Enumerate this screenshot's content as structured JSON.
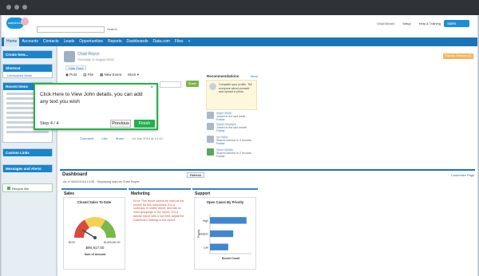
{
  "header": {
    "logo": "salesforce",
    "search_button": "Search",
    "user_menu": "Chad Brown",
    "setup": "Setup",
    "help": "Help & Training",
    "app_menu": "Sales"
  },
  "tabs": [
    "Home",
    "Accounts",
    "Contacts",
    "Leads",
    "Opportunities",
    "Reports",
    "Dashboards",
    "Data.com",
    "Files",
    "+"
  ],
  "sidebar": {
    "create_new": "Create New...",
    "shortcut": "Shortcut",
    "unresolved_items": "Unresolved Items",
    "recent_items": "Recent Items",
    "custom_links": "Custom Links",
    "messages_alerts": "Messages and Alerts",
    "recycle_bin": "Recycle Bin"
  },
  "profile": {
    "name": "Chad Royce",
    "date": "Thursday 11 August 2016",
    "hide_feed": "Hide Feed",
    "badge": "Popular Session (2)"
  },
  "publisher": {
    "post": "Post",
    "file": "File",
    "new_event": "New Event",
    "more": "More",
    "share": "Share"
  },
  "feed": {
    "actions": [
      "Comment",
      "Like",
      "Share"
    ],
    "timestamp": "04 July 2016 at 13:10"
  },
  "recommendations": {
    "title": "Recommendations",
    "more": "More",
    "profile_prompt": "Complete your profile. Tell everyone about yourself and upload a photo.",
    "items": [
      {
        "name": "Adam Wells",
        "desc": "Joined in the last week",
        "action": "Follow"
      },
      {
        "name": "Sarah Howland",
        "desc": "Joined in the last month",
        "action": "Follow"
      },
      {
        "name": "Ivy Sales",
        "desc": "Shares interest in 3 records",
        "action": "Follow"
      },
      {
        "name": "Gwen Mosby",
        "desc": "Shares interest in 2 records",
        "action": "Follow"
      }
    ]
  },
  "dashboard": {
    "title": "Dashboard",
    "refresh": "Refresh",
    "customize": "Customize Page",
    "as_of": "As of 06/02/2016 13:35 · Displaying data as Chad Royce",
    "columns": {
      "sales": "Sales",
      "marketing": "Marketing",
      "support": "Support"
    },
    "sales_chart_title": "Closed Sales To Date",
    "gauge_value": "$90,917.00",
    "gauge_min": "$0.00",
    "gauge_max": "$1,500,000.00",
    "gauge_caption": "Sum of Amount",
    "marketing_error": "Error: This report cannot be used as the source for this component. It is a summary or matrix report, and has no more groupings or the report. It is a tabular report with a row limit; adjust the Dashboard Settings in the report.",
    "support_chart_title": "Open Cases By Priority",
    "support_xlabel": "Record Count",
    "support_ylabel": "Priority"
  },
  "guide": {
    "message": "Click Here to View John details, you can add any text you wish",
    "step": "Step 4 / 4",
    "previous": "Previous",
    "finish": "Finish",
    "close": "×"
  },
  "chart_data": [
    {
      "type": "bar",
      "title": "Open Cases By Priority",
      "xlabel": "Record Count",
      "ylabel": "Priority",
      "categories": [
        "High",
        "Medium",
        "Low"
      ],
      "values": [
        22,
        14,
        11
      ],
      "xlim": [
        0,
        25
      ]
    }
  ],
  "colors": {
    "brand": "#1a74b8",
    "guide_border": "#23b14d",
    "bar": "#3f86cf"
  }
}
